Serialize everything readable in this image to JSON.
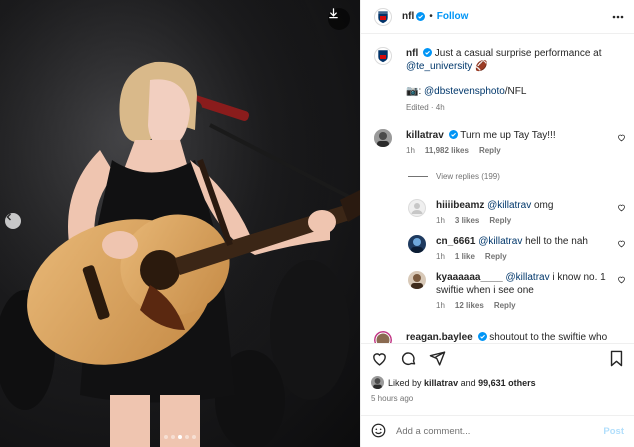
{
  "post": {
    "username": "nfl",
    "follow_label": "Follow",
    "caption_text": "Just a casual surprise performance at",
    "caption_mention": "@te_university",
    "caption_emoji": "🏈",
    "photo_credit_prefix": "📷:",
    "photo_credit_mention": "@dbstevensphoto",
    "photo_credit_suffix": "/NFL",
    "edited": "Edited · 4h",
    "carousel_dots": 5,
    "active_dot": 2
  },
  "comments": [
    {
      "username": "killatrav",
      "verified": true,
      "text": "Turn me up Tay Tay!!!",
      "time": "1h",
      "likes": "11,982 likes",
      "reply": "Reply"
    },
    {
      "username": "hiiiibeamz",
      "mention": "@killatrav",
      "text": "omg",
      "time": "1h",
      "likes": "3 likes",
      "reply": "Reply"
    },
    {
      "username": "cn_6661",
      "mention": "@killatrav",
      "text": "hell to the nah",
      "time": "1h",
      "likes": "1 like",
      "reply": "Reply"
    },
    {
      "username": "kyaaaaaa____",
      "mention": "@killatrav",
      "text": "i know no. 1 swiftie when i see one",
      "time": "1h",
      "likes": "12 likes",
      "reply": "Reply"
    },
    {
      "username": "reagan.baylee",
      "verified": true,
      "text": "shoutout to the swiftie who"
    }
  ],
  "view_replies": "View replies (199)",
  "likes_summary": {
    "prefix": "Liked by",
    "user": "killatrav",
    "middle": "and",
    "count": "99,631 others"
  },
  "posted_ago": "5 hours ago",
  "add_comment": {
    "placeholder": "Add a comment...",
    "post_label": "Post"
  },
  "icons": [
    "download-icon",
    "chevron-left-icon",
    "more-icon",
    "heart-icon",
    "comment-icon",
    "share-icon",
    "bookmark-icon",
    "emoji-icon"
  ],
  "colors": {
    "link": "#00376b",
    "follow": "#0095f6",
    "verified": "#0095f6",
    "post_disabled": "#b2dffc",
    "muted": "#737373"
  }
}
